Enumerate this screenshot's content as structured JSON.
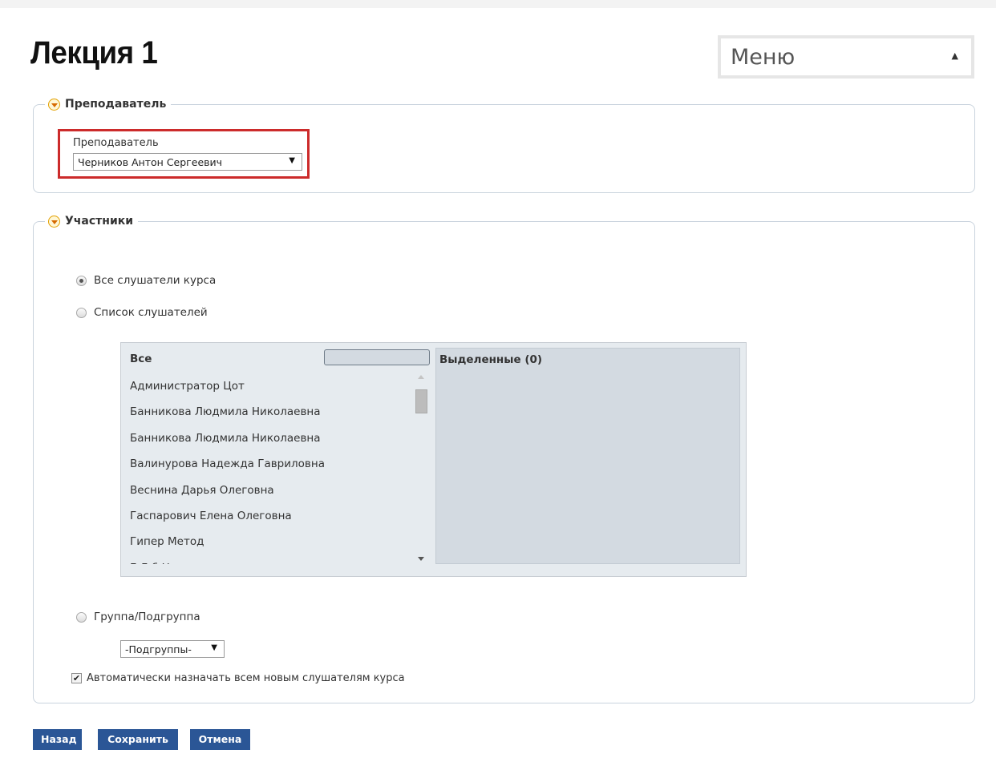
{
  "page": {
    "title": "Лекция 1"
  },
  "menu": {
    "label": "Меню",
    "arrow": "▲"
  },
  "teacher_section": {
    "legend": "Преподаватель",
    "field_label": "Преподаватель",
    "selected_value": "Черников Антон Сергеевич",
    "dropdown_arrow": "▼"
  },
  "participants_section": {
    "legend": "Участники",
    "options": {
      "all_course": {
        "label": "Все слушатели курса",
        "checked": true
      },
      "student_list": {
        "label": "Список слушателей",
        "checked": false
      },
      "group": {
        "label": "Группа/Подгруппа",
        "checked": false
      }
    },
    "picker": {
      "all_title": "Все",
      "selected_title": "Выделенные (0)",
      "items": [
        "Администратор Цот",
        "Банникова Людмила Николаевна",
        "Банникова Людмила Николаевна",
        "Валинурова Надежда Гавриловна",
        "Веснина Дарья Олеговна",
        "Гаспарович Елена Олеговна",
        "Гипер Метод",
        "Г         Л   б    Н"
      ]
    },
    "subgroup_select": {
      "value": "-Подгруппы-",
      "arrow": "▼"
    },
    "auto_assign": {
      "label": "Автоматически назначать всем новым слушателям курса",
      "checked": true,
      "mark": "✔"
    }
  },
  "buttons": {
    "back": "Назад",
    "save": "Сохранить",
    "cancel": "Отмена"
  },
  "colors": {
    "button_bg": "#2b5696",
    "highlight": "#cc2b2b",
    "section_border": "#c9d3dd",
    "toggle": "#e2a000"
  }
}
